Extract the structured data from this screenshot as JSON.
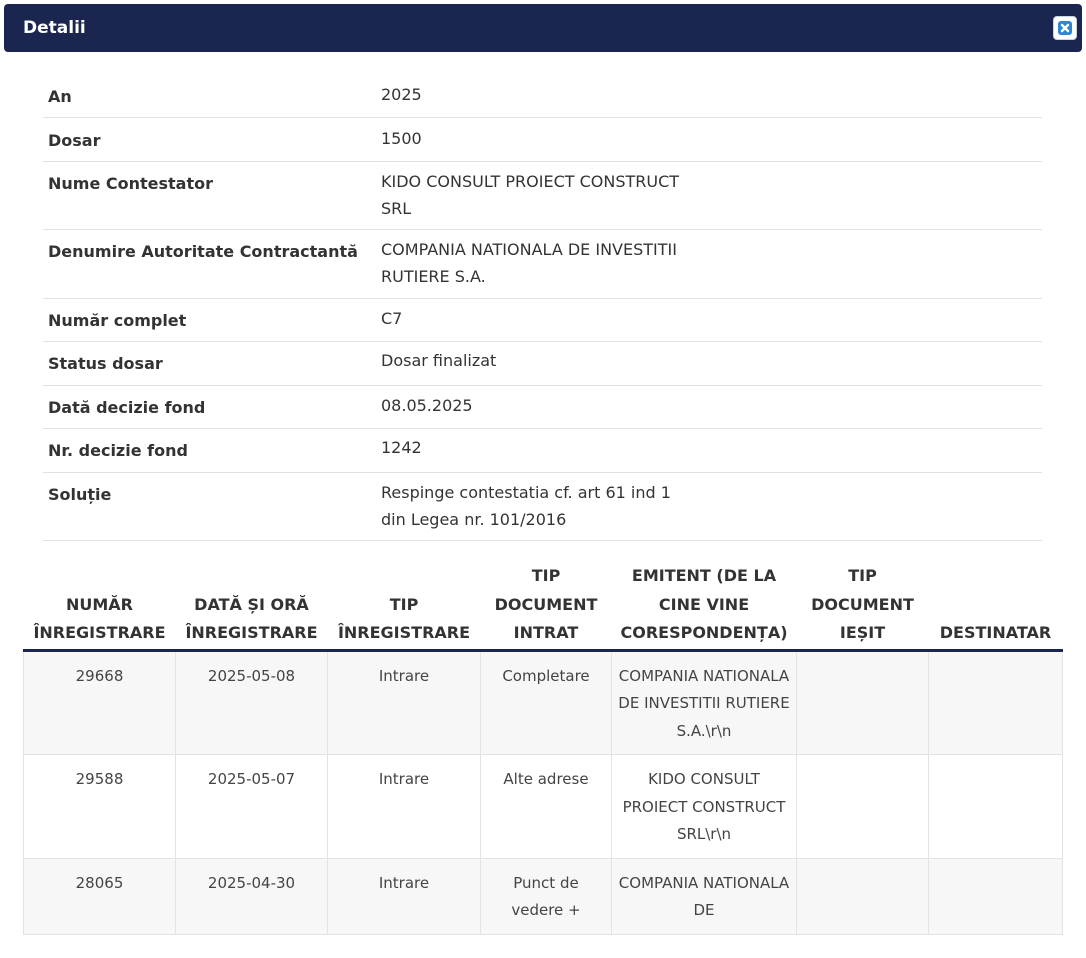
{
  "dialog": {
    "title": "Detalii",
    "close_icon": "close-icon"
  },
  "details": [
    {
      "label": "An",
      "value": "2025"
    },
    {
      "label": "Dosar",
      "value": "1500"
    },
    {
      "label": "Nume Contestator",
      "value": "KIDO CONSULT PROIECT CONSTRUCT\nSRL"
    },
    {
      "label": "Denumire Autoritate Contractantă",
      "value": "COMPANIA NATIONALA DE INVESTITII\nRUTIERE S.A."
    },
    {
      "label": "Număr complet",
      "value": "C7"
    },
    {
      "label": "Status dosar",
      "value": "Dosar finalizat"
    },
    {
      "label": "Dată decizie fond",
      "value": "08.05.2025"
    },
    {
      "label": "Nr. decizie fond",
      "value": "1242"
    },
    {
      "label": "Soluție",
      "value": "Respinge contestatia cf. art 61 ind 1\ndin Legea nr. 101/2016"
    }
  ],
  "table": {
    "headers": [
      "NUMĂR ÎNREGISTRARE",
      "DATĂ ȘI ORĂ ÎNREGISTRARE",
      "TIP ÎNREGISTRARE",
      "TIP DOCUMENT INTRAT",
      "EMITENT (DE LA CINE VINE CORESPONDENȚA)",
      "TIP DOCUMENT IEȘIT",
      "DESTINATAR"
    ],
    "rows": [
      [
        "29668",
        "2025-05-08",
        "Intrare",
        "Completare",
        "COMPANIA NATIONALA DE INVESTITII RUTIERE S.A.\\r\\n",
        "",
        ""
      ],
      [
        "29588",
        "2025-05-07",
        "Intrare",
        "Alte adrese",
        "KIDO CONSULT PROIECT CONSTRUCT SRL\\r\\n",
        "",
        ""
      ],
      [
        "28065",
        "2025-04-30",
        "Intrare",
        "Punct de vedere +",
        "COMPANIA NATIONALA DE",
        "",
        ""
      ]
    ]
  },
  "colors": {
    "titlebar": "#1b2650",
    "header_rule": "#1b2650",
    "row_odd": "#f7f7f7",
    "row_even": "#ffffff"
  }
}
